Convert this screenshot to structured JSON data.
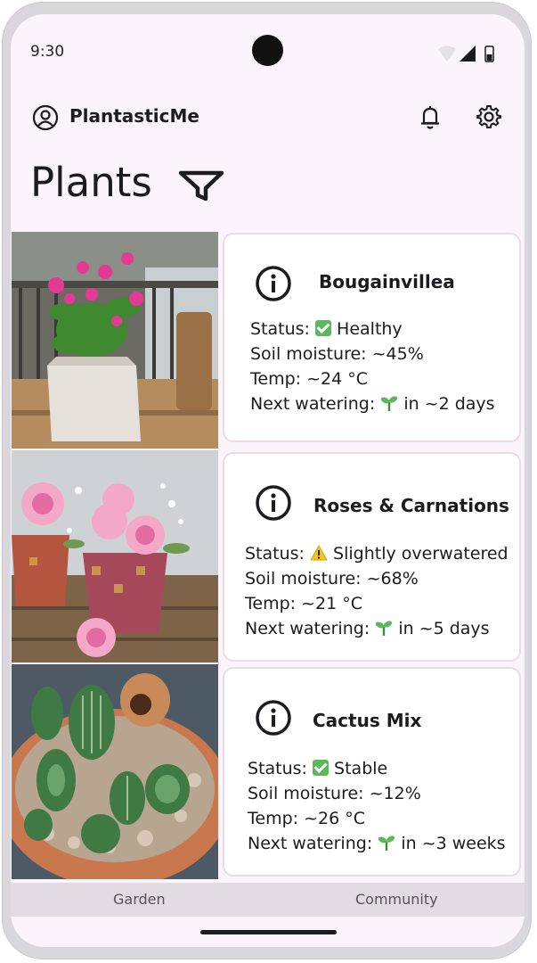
{
  "status_bar": {
    "time": "9:30"
  },
  "app": {
    "name": "PlantasticMe"
  },
  "page": {
    "title": "Plants"
  },
  "plants": [
    {
      "name": "Bougainvillea",
      "status_label": "Status:",
      "status_text": "Healthy",
      "status_icon": "check-emoji",
      "moisture": "Soil moisture: ~45%",
      "temp": "Temp: ~24 °C",
      "watering_label": "Next watering:",
      "watering_text": "in ~2 days",
      "image": "bougainvillea-photo"
    },
    {
      "name": "Roses & Carnations",
      "status_label": "Status:",
      "status_text": "Slightly overwatered",
      "status_icon": "warning-emoji",
      "moisture": "Soil moisture: ~68%",
      "temp": "Temp: ~21 °C",
      "watering_label": "Next watering:",
      "watering_text": "in ~5 days",
      "image": "roses-carnations-photo"
    },
    {
      "name": "Cactus Mix",
      "status_label": "Status:",
      "status_text": "Stable",
      "status_icon": "check-emoji",
      "moisture": "Soil moisture: ~12%",
      "temp": "Temp: ~26 °C",
      "watering_label": "Next watering:",
      "watering_text": "in ~3 weeks",
      "image": "cactus-mix-photo"
    }
  ],
  "bottom_nav": {
    "garden": "Garden",
    "community": "Community"
  },
  "colors": {
    "background": "#fcf4fb",
    "card_border": "#eadbe6",
    "nav_bg": "#e1dbe2",
    "healthy": "#5cb85c",
    "sprout": "#4caf50"
  }
}
